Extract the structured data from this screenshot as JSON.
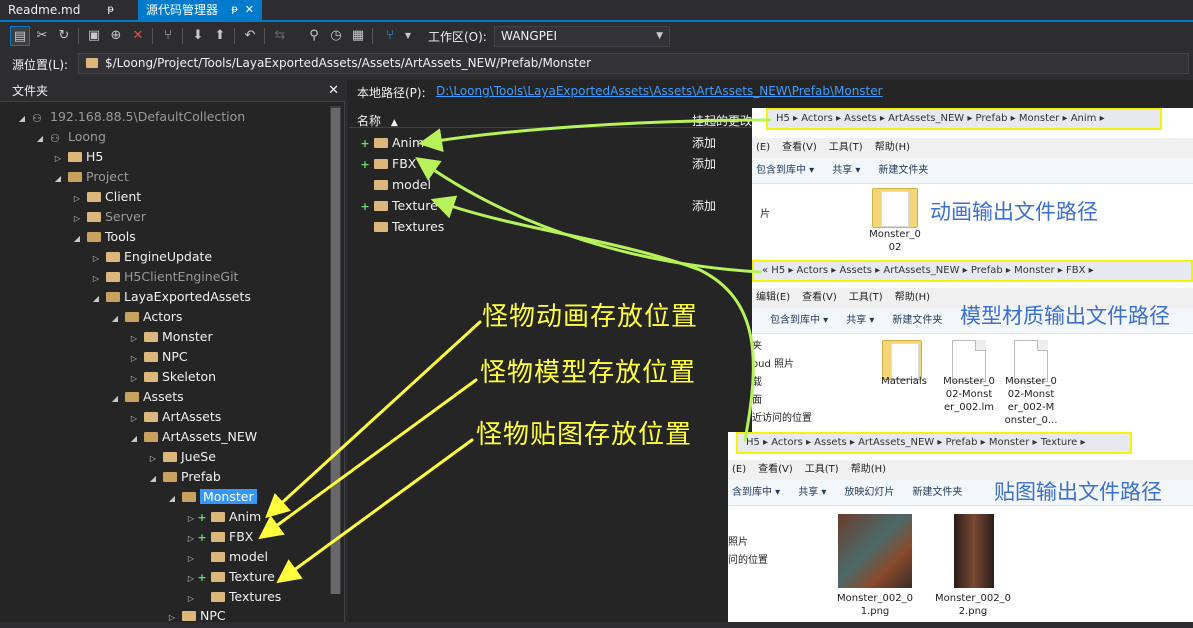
{
  "tabs": [
    {
      "label": "Readme.md",
      "pin": "ᵽ"
    },
    {
      "label": "源代码管理器",
      "pin": "ᵽ",
      "close": "✕"
    }
  ],
  "toolbar": {
    "workspace_label": "工作区(O):",
    "workspace_value": "WANGPEI"
  },
  "source": {
    "label": "源位置(L):",
    "path": "$/Loong/Project/Tools/LayaExportedAssets/Assets/ArtAssets_NEW/Prefab/Monster"
  },
  "left": {
    "title": "文件夹",
    "close": "✕",
    "tree": [
      {
        "label": "192.168.88.5\\DefaultCollection"
      },
      {
        "label": "Loong"
      },
      {
        "label": "H5"
      },
      {
        "label": "Project"
      },
      {
        "label": "Client"
      },
      {
        "label": "Server"
      },
      {
        "label": "Tools"
      },
      {
        "label": "EngineUpdate"
      },
      {
        "label": "H5ClientEngineGit"
      },
      {
        "label": "LayaExportedAssets"
      },
      {
        "label": "Actors"
      },
      {
        "label": "Monster"
      },
      {
        "label": "NPC"
      },
      {
        "label": "Skeleton"
      },
      {
        "label": "Assets"
      },
      {
        "label": "ArtAssets"
      },
      {
        "label": "ArtAssets_NEW"
      },
      {
        "label": "JueSe"
      },
      {
        "label": "Prefab"
      },
      {
        "label": "Monster"
      },
      {
        "label": "Anim"
      },
      {
        "label": "FBX"
      },
      {
        "label": "model"
      },
      {
        "label": "Texture"
      },
      {
        "label": "Textures"
      },
      {
        "label": "NPC"
      }
    ]
  },
  "right": {
    "local_label": "本地路径(P):",
    "local_path": "D:\\Loong\\Tools\\LayaExportedAssets\\Assets\\ArtAssets_NEW\\Prefab\\Monster",
    "col_name": "名称",
    "col_status": "挂起的更改",
    "files": [
      {
        "name": "Anim",
        "status": "添加"
      },
      {
        "name": "FBX",
        "status": "添加"
      },
      {
        "name": "model",
        "status": ""
      },
      {
        "name": "Texture",
        "status": "添加"
      },
      {
        "name": "Textures",
        "status": ""
      }
    ]
  },
  "explorers": [
    {
      "crumbs": "H5  ▸  Actors  ▸  Assets  ▸  ArtAssets_NEW  ▸  Prefab  ▸  Monster  ▸  Anim  ▸",
      "menu": [
        "(E)",
        "查看(V)",
        "工具(T)",
        "帮助(H)"
      ],
      "cmds": [
        "包含到库中 ▾",
        "共享 ▾",
        "新建文件夹"
      ],
      "side": [
        "片",
        "",
        "",
        ""
      ],
      "title": "动画输出文件路径",
      "items": [
        {
          "name": "Monster_0\n02"
        }
      ]
    },
    {
      "crumbs": "«  H5  ▸  Actors  ▸  Assets  ▸  ArtAssets_NEW  ▸  Prefab  ▸  Monster  ▸  FBX  ▸",
      "menu": [
        "编辑(E)",
        "查看(V)",
        "工具(T)",
        "帮助(H)"
      ],
      "cmds": [
        "包含到库中 ▾",
        "共享 ▾",
        "新建文件夹"
      ],
      "side": [
        "夹",
        "oud 照片",
        "载",
        "面",
        "近访问的位置"
      ],
      "title": "模型材质输出文件路径",
      "items": [
        {
          "name": "Materials"
        },
        {
          "name": "Monster_0\n02-Monst\ner_002.lm"
        },
        {
          "name": "Monster_0\n02-Monst\ner_002-M\nonster_0..."
        }
      ]
    },
    {
      "crumbs": "H5  ▸  Actors  ▸  Assets  ▸  ArtAssets_NEW  ▸  Prefab  ▸  Monster  ▸  Texture  ▸",
      "menu": [
        "(E)",
        "查看(V)",
        "工具(T)",
        "帮助(H)"
      ],
      "cmds": [
        "含到库中 ▾",
        "共享 ▾",
        "放映幻灯片",
        "新建文件夹"
      ],
      "side": [
        "照片",
        "",
        "",
        "问的位置"
      ],
      "title": "贴图输出文件路径",
      "items": [
        {
          "name": "Monster_002_0\n1.png"
        },
        {
          "name": "Monster_002_0\n2.png"
        }
      ]
    }
  ],
  "annotations": [
    "怪物动画存放位置",
    "怪物模型存放位置",
    "怪物贴图存放位置"
  ],
  "colors": {
    "accent": "#007acc",
    "annotation": "#ffff3c",
    "arrow_green": "#b8f25a",
    "link": "#3e9cff"
  }
}
